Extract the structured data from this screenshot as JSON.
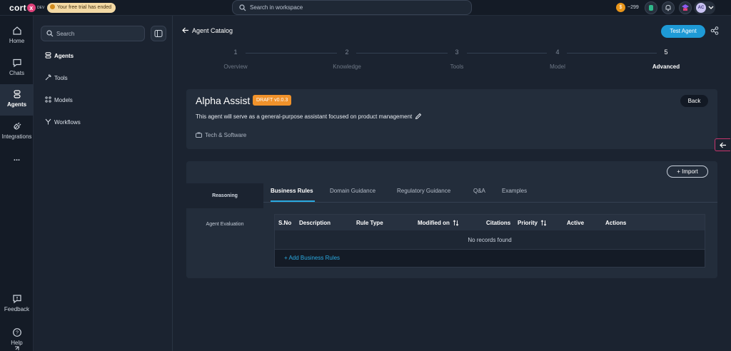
{
  "topbar": {
    "logo_text": "cort",
    "logo_x": "x",
    "env_label": "DEV",
    "trial_text": "Your free trial has ended",
    "search_placeholder": "Search in workspace",
    "credits": "~299",
    "avatar_initials": "AC"
  },
  "rail": {
    "items": [
      {
        "label": "Home",
        "icon": "home-icon"
      },
      {
        "label": "Chats",
        "icon": "chat-icon"
      },
      {
        "label": "Agents",
        "icon": "agents-icon"
      },
      {
        "label": "Integrations",
        "icon": "plug-icon"
      },
      {
        "label": "...",
        "icon": "more-icon"
      }
    ],
    "active": "Agents",
    "feedback_label": "Feedback",
    "help_label": "Help"
  },
  "nav": {
    "search_placeholder": "Search",
    "items": [
      {
        "label": "Agents",
        "icon": "agents-icon"
      },
      {
        "label": "Tools",
        "icon": "wrench-icon"
      },
      {
        "label": "Models",
        "icon": "models-icon"
      },
      {
        "label": "Workflows",
        "icon": "workflow-icon"
      }
    ]
  },
  "main": {
    "breadcrumb": "Agent Catalog",
    "test_agent_label": "Test Agent",
    "steps": [
      {
        "num": "1",
        "name": "Overview"
      },
      {
        "num": "2",
        "name": "Knowledge"
      },
      {
        "num": "3",
        "name": "Tools"
      },
      {
        "num": "4",
        "name": "Model"
      },
      {
        "num": "5",
        "name": "Advanced"
      }
    ],
    "current_step": 5,
    "agent": {
      "name": "Alpha Assist",
      "badge": "DRAFT v0.0.3",
      "description": "This agent will serve as a general-purpose assistant focused on product management",
      "industry": "Tech & Software",
      "back_label": "Back"
    },
    "import_label": "Import",
    "side_tabs": [
      "Reasoning",
      "Agent Evaluation"
    ],
    "tabs": [
      "Business Rules",
      "Domain Guidance",
      "Regulatory Guidance",
      "Q&A",
      "Examples"
    ],
    "active_tab": "Business Rules",
    "table": {
      "columns": [
        "S.No",
        "Description",
        "Rule Type",
        "Modified on",
        "Citations",
        "Priority",
        "Active",
        "Actions"
      ],
      "empty_text": "No records found",
      "add_label": "+ Add Business Rules"
    }
  },
  "colors": {
    "accent": "#2aa9e0",
    "primary_button": "#1e9ad6",
    "draft_badge": "#f0922b",
    "background": "#1b2330"
  }
}
